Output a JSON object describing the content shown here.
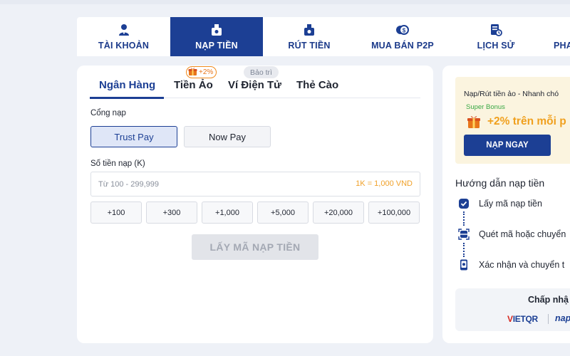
{
  "nav": {
    "items": [
      {
        "label": "TÀI KHOẢN",
        "icon": "user-icon"
      },
      {
        "label": "NẠP TIỀN",
        "icon": "deposit-icon",
        "active": true
      },
      {
        "label": "RÚT TIỀN",
        "icon": "withdraw-icon"
      },
      {
        "label": "MUA BÁN P2P",
        "icon": "p2p-coins-icon"
      },
      {
        "label": "LỊCH SỬ",
        "icon": "history-icon"
      },
      {
        "label": "PHA",
        "icon": "cut-off-icon"
      }
    ]
  },
  "deposit": {
    "tabs": [
      {
        "label": "Ngân Hàng",
        "active": true
      },
      {
        "label": "Tiền Ảo"
      },
      {
        "label": "Ví Điện Tử"
      },
      {
        "label": "Thẻ Cào"
      }
    ],
    "bonus_badge": "+2%",
    "maintenance_badge": "Bảo trì",
    "gateway_label": "Cổng nạp",
    "gateways": [
      "Trust Pay",
      "Now Pay"
    ],
    "amount_label": "Số tiền nạp (K)",
    "amount_placeholder": "Từ 100 - 299,999",
    "rate_text": "1K = 1,000 VND",
    "quick_amounts": [
      "+100",
      "+300",
      "+1,000",
      "+5,000",
      "+20,000",
      "+100,000"
    ],
    "submit_label": "LẤY MÃ NẠP TIỀN"
  },
  "side": {
    "promo": {
      "title": "Nạp/Rút tiền ảo - Nhanh chó",
      "sub": "Super Bonus",
      "big": "+2% trên mỗi p",
      "button": "NẠP NGAY"
    },
    "guide_title": "Hướng dẫn nạp tiền",
    "steps": [
      {
        "text": "Lấy mã nạp tiền",
        "icon": "check-shield-icon"
      },
      {
        "text": "Quét mã hoặc chuyển",
        "icon": "qr-scan-icon"
      },
      {
        "text": "Xác nhận và chuyển t",
        "icon": "phone-confirm-icon"
      }
    ],
    "accept_title": "Chấp nhậ",
    "logos": {
      "vietqr_v": "V",
      "vietqr_rest": "IETQR",
      "napas": "nap"
    }
  },
  "colors": {
    "primary": "#1c3f94",
    "accent": "#f0a01e",
    "bonus_green": "#3aa845",
    "background": "#eef1f7"
  }
}
